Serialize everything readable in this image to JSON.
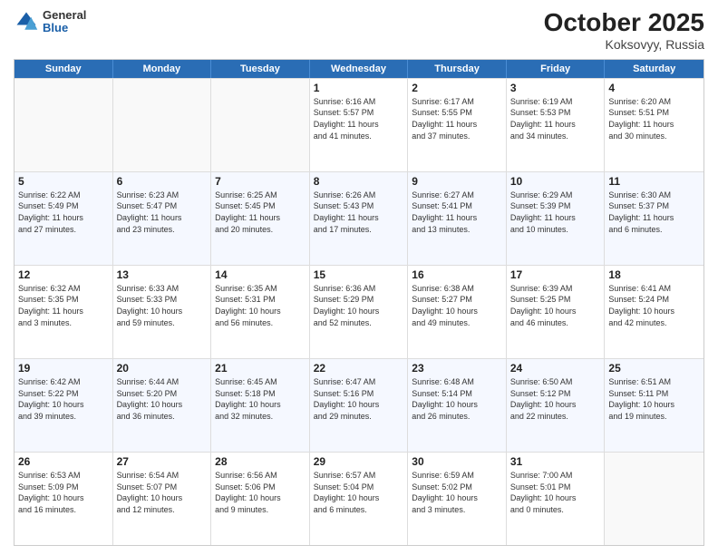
{
  "header": {
    "logo_general": "General",
    "logo_blue": "Blue",
    "month_title": "October 2025",
    "location": "Koksovyy, Russia"
  },
  "weekdays": [
    "Sunday",
    "Monday",
    "Tuesday",
    "Wednesday",
    "Thursday",
    "Friday",
    "Saturday"
  ],
  "rows": [
    [
      {
        "day": "",
        "info": ""
      },
      {
        "day": "",
        "info": ""
      },
      {
        "day": "",
        "info": ""
      },
      {
        "day": "1",
        "info": "Sunrise: 6:16 AM\nSunset: 5:57 PM\nDaylight: 11 hours\nand 41 minutes."
      },
      {
        "day": "2",
        "info": "Sunrise: 6:17 AM\nSunset: 5:55 PM\nDaylight: 11 hours\nand 37 minutes."
      },
      {
        "day": "3",
        "info": "Sunrise: 6:19 AM\nSunset: 5:53 PM\nDaylight: 11 hours\nand 34 minutes."
      },
      {
        "day": "4",
        "info": "Sunrise: 6:20 AM\nSunset: 5:51 PM\nDaylight: 11 hours\nand 30 minutes."
      }
    ],
    [
      {
        "day": "5",
        "info": "Sunrise: 6:22 AM\nSunset: 5:49 PM\nDaylight: 11 hours\nand 27 minutes."
      },
      {
        "day": "6",
        "info": "Sunrise: 6:23 AM\nSunset: 5:47 PM\nDaylight: 11 hours\nand 23 minutes."
      },
      {
        "day": "7",
        "info": "Sunrise: 6:25 AM\nSunset: 5:45 PM\nDaylight: 11 hours\nand 20 minutes."
      },
      {
        "day": "8",
        "info": "Sunrise: 6:26 AM\nSunset: 5:43 PM\nDaylight: 11 hours\nand 17 minutes."
      },
      {
        "day": "9",
        "info": "Sunrise: 6:27 AM\nSunset: 5:41 PM\nDaylight: 11 hours\nand 13 minutes."
      },
      {
        "day": "10",
        "info": "Sunrise: 6:29 AM\nSunset: 5:39 PM\nDaylight: 11 hours\nand 10 minutes."
      },
      {
        "day": "11",
        "info": "Sunrise: 6:30 AM\nSunset: 5:37 PM\nDaylight: 11 hours\nand 6 minutes."
      }
    ],
    [
      {
        "day": "12",
        "info": "Sunrise: 6:32 AM\nSunset: 5:35 PM\nDaylight: 11 hours\nand 3 minutes."
      },
      {
        "day": "13",
        "info": "Sunrise: 6:33 AM\nSunset: 5:33 PM\nDaylight: 10 hours\nand 59 minutes."
      },
      {
        "day": "14",
        "info": "Sunrise: 6:35 AM\nSunset: 5:31 PM\nDaylight: 10 hours\nand 56 minutes."
      },
      {
        "day": "15",
        "info": "Sunrise: 6:36 AM\nSunset: 5:29 PM\nDaylight: 10 hours\nand 52 minutes."
      },
      {
        "day": "16",
        "info": "Sunrise: 6:38 AM\nSunset: 5:27 PM\nDaylight: 10 hours\nand 49 minutes."
      },
      {
        "day": "17",
        "info": "Sunrise: 6:39 AM\nSunset: 5:25 PM\nDaylight: 10 hours\nand 46 minutes."
      },
      {
        "day": "18",
        "info": "Sunrise: 6:41 AM\nSunset: 5:24 PM\nDaylight: 10 hours\nand 42 minutes."
      }
    ],
    [
      {
        "day": "19",
        "info": "Sunrise: 6:42 AM\nSunset: 5:22 PM\nDaylight: 10 hours\nand 39 minutes."
      },
      {
        "day": "20",
        "info": "Sunrise: 6:44 AM\nSunset: 5:20 PM\nDaylight: 10 hours\nand 36 minutes."
      },
      {
        "day": "21",
        "info": "Sunrise: 6:45 AM\nSunset: 5:18 PM\nDaylight: 10 hours\nand 32 minutes."
      },
      {
        "day": "22",
        "info": "Sunrise: 6:47 AM\nSunset: 5:16 PM\nDaylight: 10 hours\nand 29 minutes."
      },
      {
        "day": "23",
        "info": "Sunrise: 6:48 AM\nSunset: 5:14 PM\nDaylight: 10 hours\nand 26 minutes."
      },
      {
        "day": "24",
        "info": "Sunrise: 6:50 AM\nSunset: 5:12 PM\nDaylight: 10 hours\nand 22 minutes."
      },
      {
        "day": "25",
        "info": "Sunrise: 6:51 AM\nSunset: 5:11 PM\nDaylight: 10 hours\nand 19 minutes."
      }
    ],
    [
      {
        "day": "26",
        "info": "Sunrise: 6:53 AM\nSunset: 5:09 PM\nDaylight: 10 hours\nand 16 minutes."
      },
      {
        "day": "27",
        "info": "Sunrise: 6:54 AM\nSunset: 5:07 PM\nDaylight: 10 hours\nand 12 minutes."
      },
      {
        "day": "28",
        "info": "Sunrise: 6:56 AM\nSunset: 5:06 PM\nDaylight: 10 hours\nand 9 minutes."
      },
      {
        "day": "29",
        "info": "Sunrise: 6:57 AM\nSunset: 5:04 PM\nDaylight: 10 hours\nand 6 minutes."
      },
      {
        "day": "30",
        "info": "Sunrise: 6:59 AM\nSunset: 5:02 PM\nDaylight: 10 hours\nand 3 minutes."
      },
      {
        "day": "31",
        "info": "Sunrise: 7:00 AM\nSunset: 5:01 PM\nDaylight: 10 hours\nand 0 minutes."
      },
      {
        "day": "",
        "info": ""
      }
    ]
  ]
}
